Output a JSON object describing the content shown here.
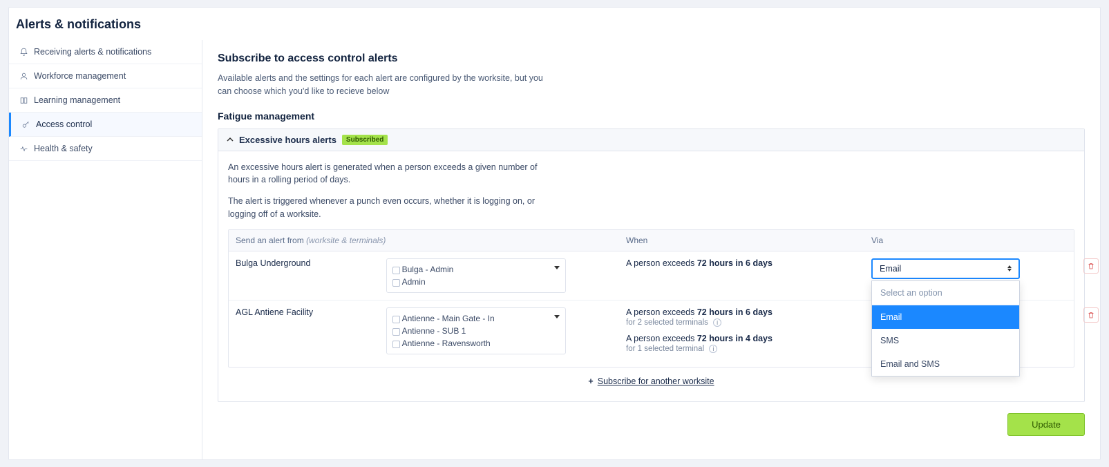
{
  "page_title": "Alerts & notifications",
  "sidebar": {
    "items": [
      {
        "label": "Receiving alerts & notifications",
        "icon": "bell-icon"
      },
      {
        "label": "Workforce management",
        "icon": "person-icon"
      },
      {
        "label": "Learning management",
        "icon": "book-icon"
      },
      {
        "label": "Access control",
        "icon": "key-icon",
        "active": true
      },
      {
        "label": "Health & safety",
        "icon": "heartbeat-icon"
      }
    ]
  },
  "main": {
    "heading": "Subscribe to access control alerts",
    "description": "Available alerts and the settings for each alert are configured by the worksite, but you can choose which you'd like to recieve below",
    "section_title": "Fatigue management"
  },
  "accordion": {
    "title": "Excessive hours alerts",
    "badge": "Subscribed",
    "desc1": "An excessive hours alert is generated when a person exceeds a given number of hours in a rolling period of days.",
    "desc2": "The alert is triggered whenever a punch even occurs, whether it is logging on, or logging off of a worksite."
  },
  "table": {
    "header_from_prefix": "Send an alert from",
    "header_from_suffix": "(worksite & terminals)",
    "header_when": "When",
    "header_via": "Via",
    "rows": [
      {
        "worksite": "Bulga Underground",
        "terminals": [
          "Bulga - Admin",
          "Admin"
        ],
        "when": [
          {
            "prefix": "A person exceeds ",
            "bold": "72 hours in 6 days",
            "sub": null
          }
        ],
        "via_selected": "Email"
      },
      {
        "worksite": "AGL Antiene Facility",
        "terminals": [
          "Antienne - Main Gate - In",
          "Antienne - SUB 1",
          "Antienne - Ravensworth"
        ],
        "when": [
          {
            "prefix": "A person exceeds ",
            "bold": "72 hours in 6 days",
            "sub": "for 2 selected terminals"
          },
          {
            "prefix": "A person exceeds ",
            "bold": "72 hours in 4 days",
            "sub": "for 1 selected terminal"
          }
        ]
      }
    ],
    "add_label": "Subscribe for another worksite"
  },
  "via_dropdown": {
    "placeholder": "Select an option",
    "options": [
      "Email",
      "SMS",
      "Email and SMS"
    ]
  },
  "buttons": {
    "update": "Update"
  }
}
